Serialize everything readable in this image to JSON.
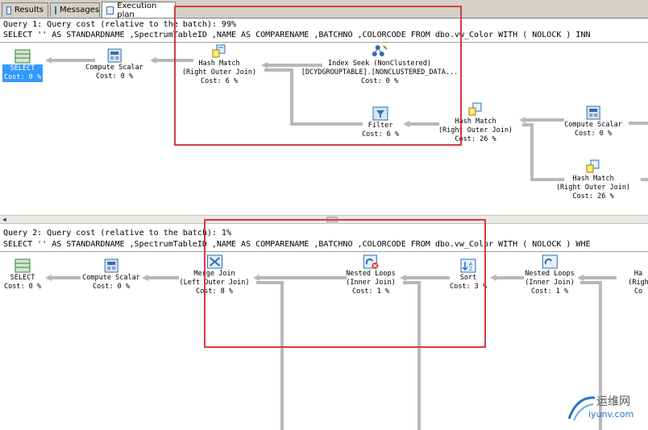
{
  "tabs": [
    {
      "label": "Results",
      "icon": "grid-icon"
    },
    {
      "label": "Messages",
      "icon": "messages-icon"
    },
    {
      "label": "Execution plan",
      "icon": "execution-plan-icon"
    }
  ],
  "query1": {
    "title": "Query 1: Query cost (relative to the batch): 99%",
    "sql": "SELECT '' AS STANDARDNAME ,SpectrumTableID ,NAME AS COMPARENAME ,BATCHNO ,COLORCODE FROM dbo.vw_Color WITH ( NOLOCK ) INN",
    "nodes": [
      {
        "name": "select",
        "line1": "SELECT",
        "line2": "",
        "cost": "Cost: 0 %"
      },
      {
        "name": "compute-scalar",
        "line1": "Compute Scalar",
        "line2": "",
        "cost": "Cost: 0 %"
      },
      {
        "name": "hash-match-1",
        "line1": "Hash Match",
        "line2": "(Right Outer Join)",
        "cost": "Cost: 6 %"
      },
      {
        "name": "index-seek",
        "line1": "Index Seek (NonClustered)",
        "line2": "[DCYDGROUPTABLE].[NONCLUSTERED_DATA...",
        "cost": "Cost: 0 %"
      },
      {
        "name": "filter",
        "line1": "Filter",
        "line2": "",
        "cost": "Cost: 6 %"
      },
      {
        "name": "hash-match-2",
        "line1": "Hash Match",
        "line2": "(Right Outer Join)",
        "cost": "Cost: 26 %"
      },
      {
        "name": "compute-scalar-2",
        "line1": "Compute Scalar",
        "line2": "",
        "cost": "Cost: 0 %"
      },
      {
        "name": "hash-match-3",
        "line1": "Hash Match",
        "line2": "(Right Outer Join)",
        "cost": "Cost: 26 %"
      }
    ]
  },
  "query2": {
    "title": "Query 2: Query cost (relative to the batch): 1%",
    "sql": "SELECT '' AS STANDARDNAME ,SpectrumTableID ,NAME AS COMPARENAME ,BATCHNO ,COLORCODE FROM dbo.vw_Color WITH ( NOLOCK ) WHE",
    "nodes": [
      {
        "name": "select",
        "line1": "SELECT",
        "line2": "",
        "cost": "Cost: 0 %"
      },
      {
        "name": "compute-scalar",
        "line1": "Compute Scalar",
        "line2": "",
        "cost": "Cost: 0 %"
      },
      {
        "name": "merge-join",
        "line1": "Merge Join",
        "line2": "(Left Outer Join)",
        "cost": "Cost: 8 %"
      },
      {
        "name": "nested-loops-1",
        "line1": "Nested Loops",
        "line2": "(Inner Join)",
        "cost": "Cost: 1 %"
      },
      {
        "name": "sort",
        "line1": "Sort",
        "line2": "",
        "cost": "Cost: 3 %"
      },
      {
        "name": "nested-loops-2",
        "line1": "Nested Loops",
        "line2": "(Inner Join)",
        "cost": "Cost: 1 %"
      },
      {
        "name": "hash-partial",
        "line1": "Ha",
        "line2": "(Righ",
        "cost": "Co"
      }
    ]
  },
  "watermark": {
    "brand": "运维网",
    "domain": "iyunv.com"
  },
  "colors": {
    "highlight": "#d83a3a",
    "selection": "#3399ff",
    "arrow": "#b8b8b8"
  }
}
